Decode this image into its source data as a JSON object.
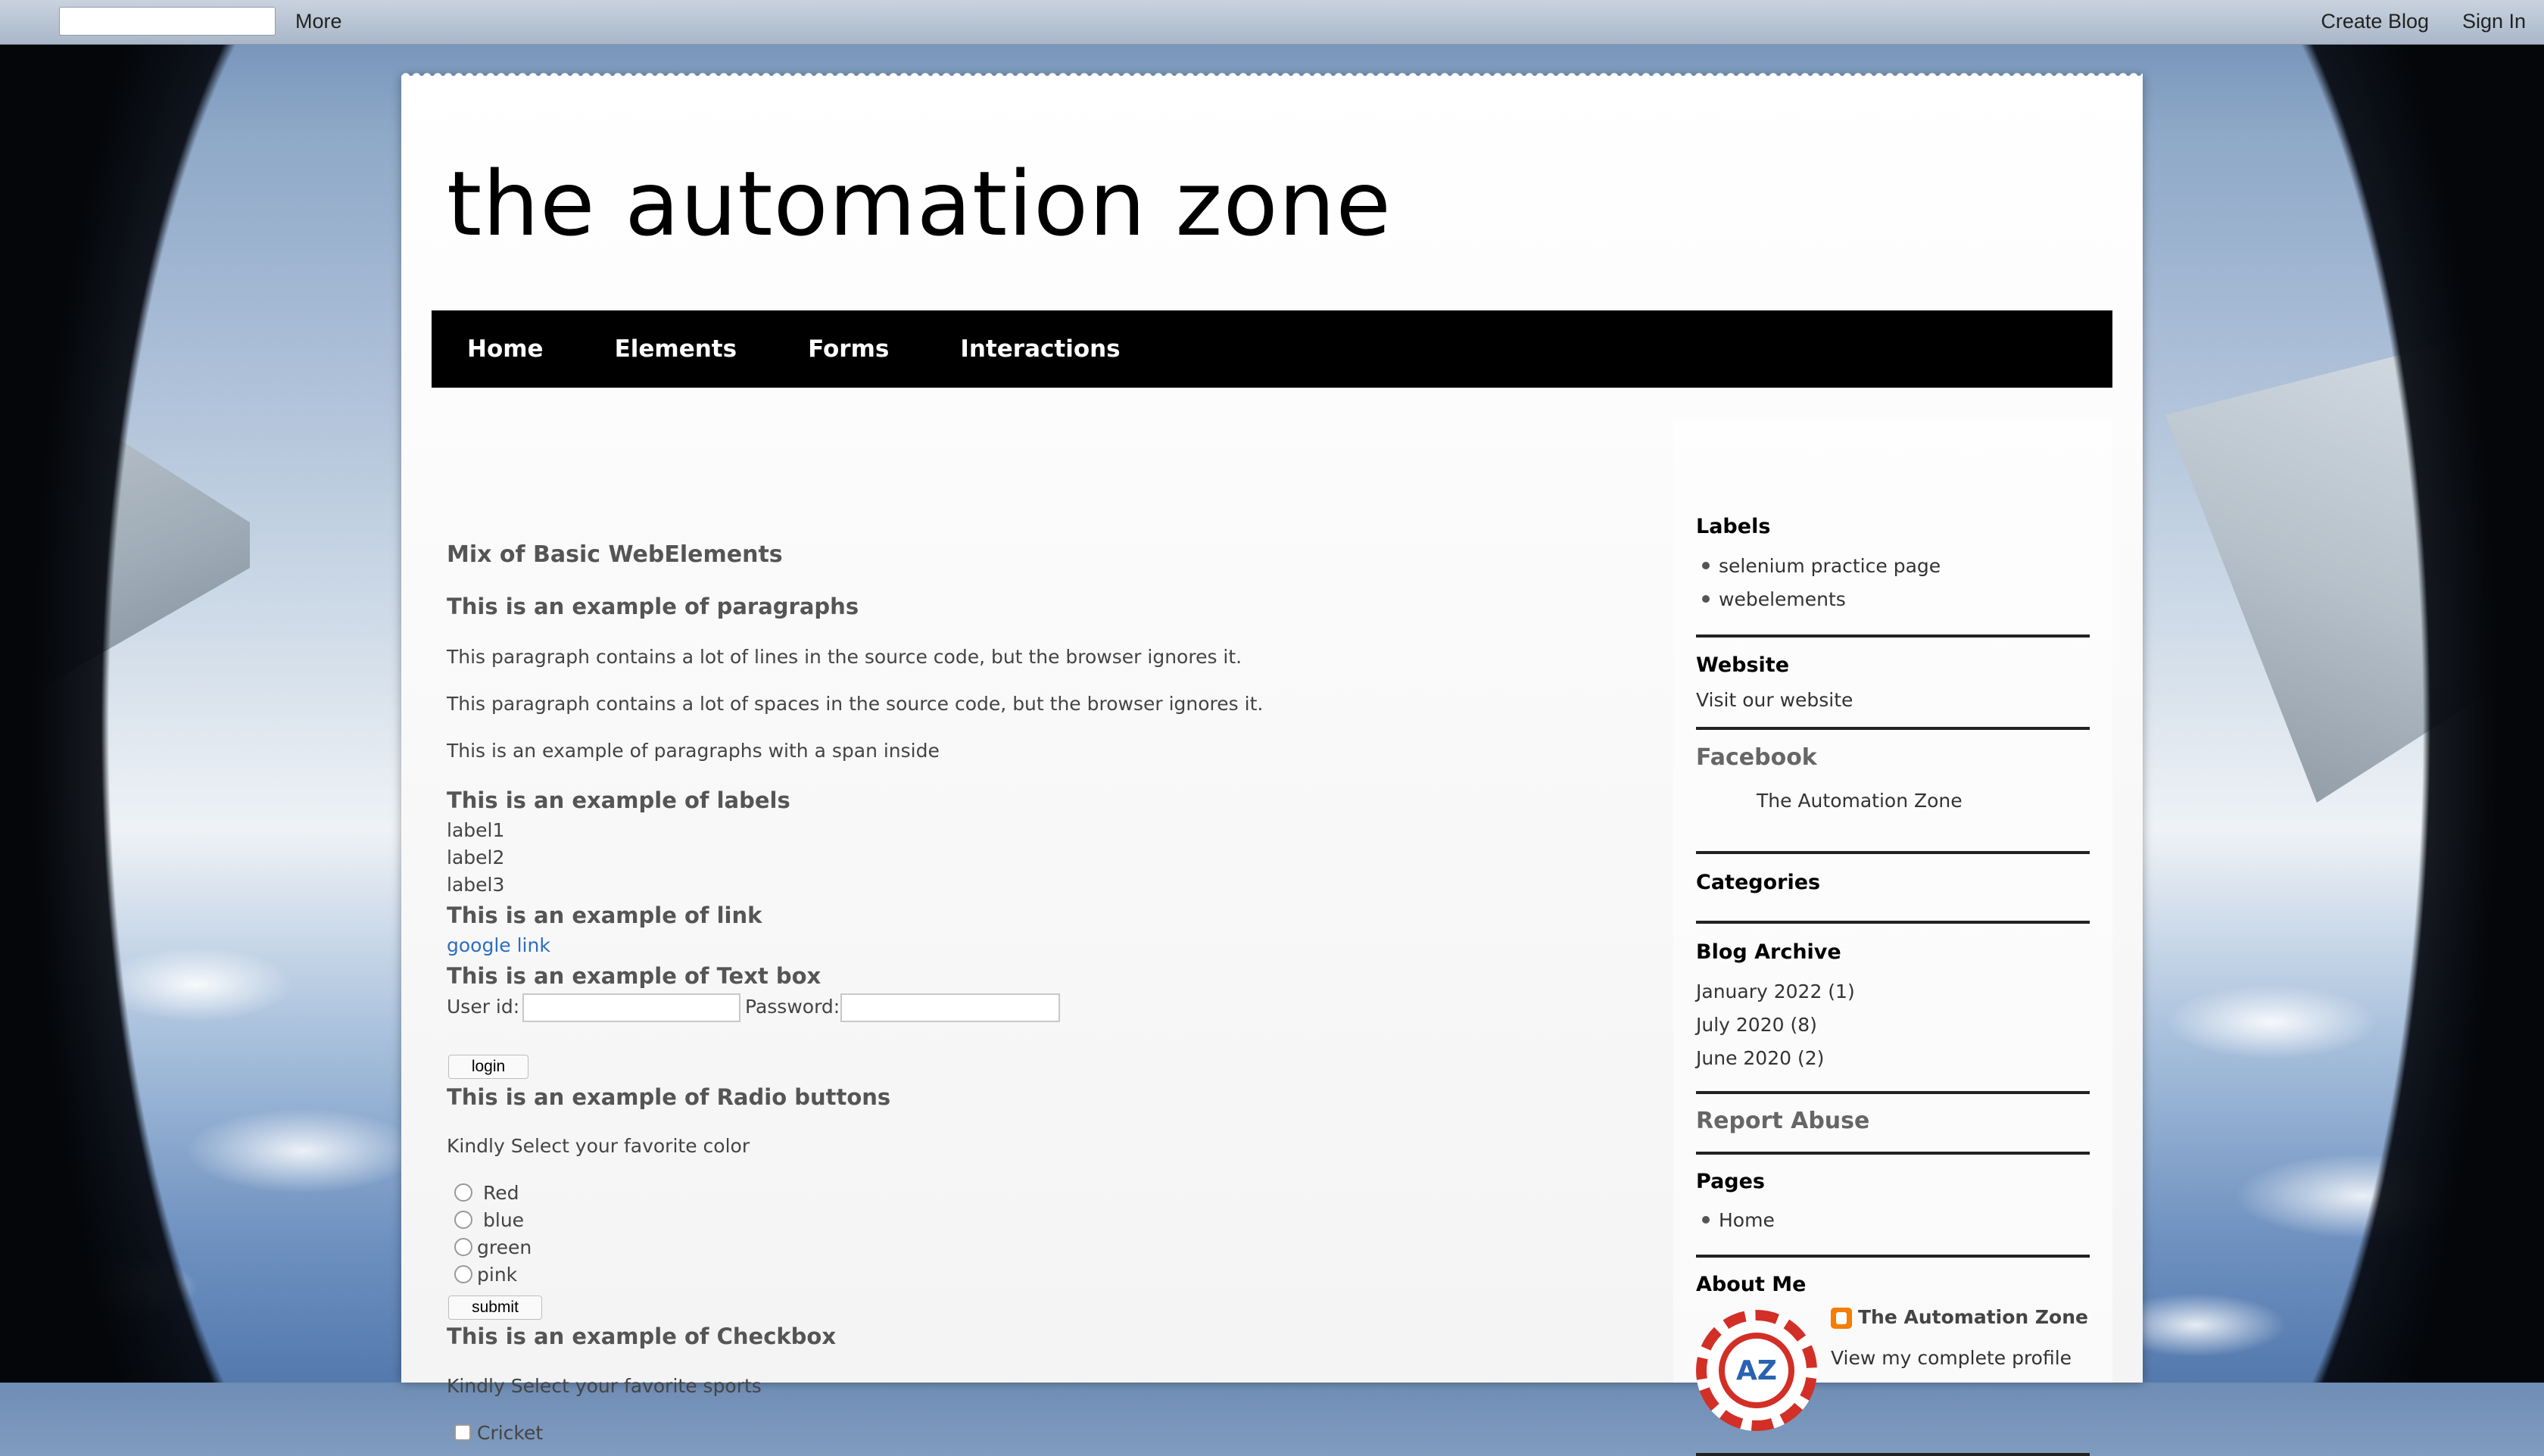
{
  "navbar": {
    "more": "More",
    "create_blog": "Create Blog",
    "sign_in": "Sign In"
  },
  "blog": {
    "title": "the automation zone",
    "tabs": [
      "Home",
      "Elements",
      "Forms",
      "Interactions"
    ]
  },
  "main": {
    "heading": "Mix of Basic WebElements",
    "paragraphs_heading": "This is an example of paragraphs",
    "paragraphs": [
      "This paragraph contains a lot of lines in the source code, but the browser ignores it.",
      "This paragraph contains a lot of spaces in the source code, but the browser ignores it.",
      "This is an example of paragraphs with a span inside"
    ],
    "labels_heading": "This is an example of labels",
    "labels": [
      "label1",
      "label2",
      "label3"
    ],
    "link_heading": "This is an example of link",
    "link_text": "google link",
    "textbox_heading": "This is an example of Text box",
    "user_id_label": "User id:",
    "password_label": "Password:",
    "user_id_value": "",
    "password_value": "",
    "login_button": "login",
    "radio_heading": "This is an example of Radio buttons",
    "radio_prompt": "Kindly Select your favorite color",
    "radio_options": [
      "Red",
      "blue",
      "green",
      "pink"
    ],
    "submit_button": "submit",
    "checkbox_heading": "This is an example of Checkbox",
    "checkbox_prompt": "Kindly Select your favorite sports",
    "checkbox_options": [
      "Cricket"
    ]
  },
  "sidebar": {
    "labels_title": "Labels",
    "labels": [
      "selenium practice page",
      "webelements"
    ],
    "website_title": "Website",
    "website_link": "Visit our website",
    "facebook_title": "Facebook",
    "facebook_text": "The Automation Zone",
    "categories_title": "Categories",
    "archive_title": "Blog Archive",
    "archive": [
      "January 2022 (1)",
      "July 2020 (8)",
      "June 2020 (2)"
    ],
    "report_abuse": "Report Abuse",
    "pages_title": "Pages",
    "pages": [
      "Home"
    ],
    "about_title": "About Me",
    "about_name": "The Automation Zone",
    "about_profile": "View my complete profile",
    "avatar_text": "AZ"
  }
}
